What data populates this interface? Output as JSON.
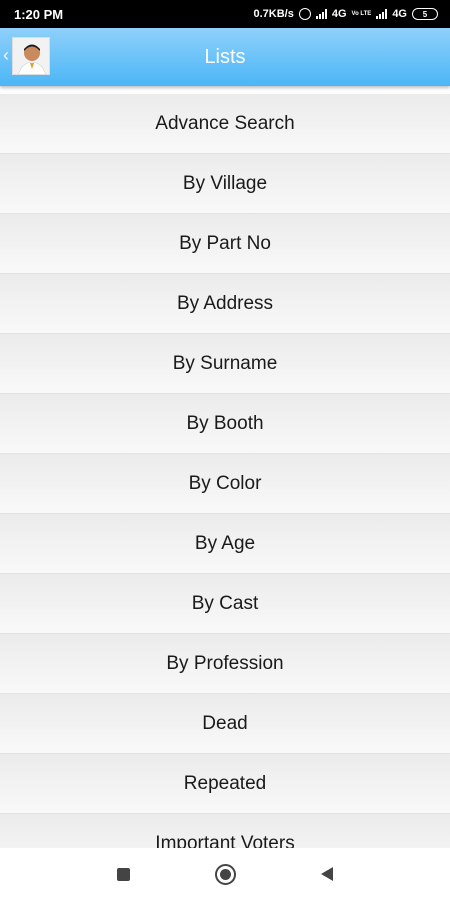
{
  "status_bar": {
    "time": "1:20 PM",
    "speed": "0.7KB/s",
    "network1": "4G",
    "volte": "Vo LTE",
    "network2": "4G",
    "battery": "5"
  },
  "header": {
    "title": "Lists",
    "back_icon": "chevron-left-icon",
    "avatar_icon": "profile-photo"
  },
  "list": {
    "items": [
      "Advance Search",
      "By Village",
      "By Part No",
      "By Address",
      "By Surname",
      "By Booth",
      "By Color",
      "By Age",
      "By Cast",
      "By Profession",
      "Dead",
      "Repeated",
      "Important Voters"
    ]
  },
  "nav_bar": {
    "recents_icon": "square-icon",
    "home_icon": "circle-icon",
    "back_icon": "triangle-back-icon"
  },
  "colors": {
    "header_top": "#8fd0fb",
    "header_bottom": "#4bb6f6",
    "status_bar": "#000000"
  }
}
